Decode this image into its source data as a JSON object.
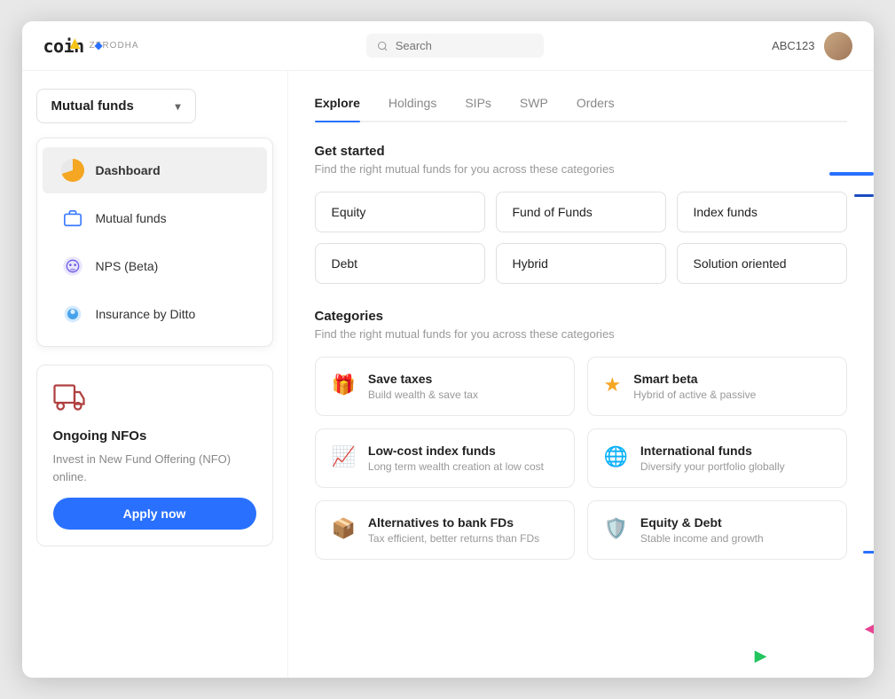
{
  "app": {
    "logo": "coin",
    "logo_sub": "ZERODHA",
    "search_placeholder": "Search"
  },
  "user": {
    "id": "ABC123"
  },
  "sidebar": {
    "dropdown_label": "Mutual funds",
    "nav_items": [
      {
        "id": "dashboard",
        "label": "Dashboard",
        "icon": "pie-chart",
        "active": true
      },
      {
        "id": "mutual-funds",
        "label": "Mutual funds",
        "icon": "briefcase",
        "active": false
      },
      {
        "id": "nps",
        "label": "NPS (Beta)",
        "icon": "nps",
        "active": false
      },
      {
        "id": "insurance",
        "label": "Insurance by Ditto",
        "icon": "droplet",
        "active": false
      }
    ],
    "nfo": {
      "title": "Ongoing NFOs",
      "description": "Invest in New Fund Offering (NFO) online.",
      "apply_label": "Apply now"
    }
  },
  "tabs": [
    {
      "id": "explore",
      "label": "Explore",
      "active": true
    },
    {
      "id": "holdings",
      "label": "Holdings",
      "active": false
    },
    {
      "id": "sips",
      "label": "SIPs",
      "active": false
    },
    {
      "id": "swp",
      "label": "SWP",
      "active": false
    },
    {
      "id": "orders",
      "label": "Orders",
      "active": false
    }
  ],
  "get_started": {
    "title": "Get started",
    "description": "Find the right mutual funds for you across these categories",
    "fund_types": [
      {
        "id": "equity",
        "label": "Equity"
      },
      {
        "id": "fund-of-funds",
        "label": "Fund of Funds"
      },
      {
        "id": "index-funds",
        "label": "Index funds"
      },
      {
        "id": "debt",
        "label": "Debt"
      },
      {
        "id": "hybrid",
        "label": "Hybrid"
      },
      {
        "id": "solution-oriented",
        "label": "Solution oriented"
      }
    ]
  },
  "categories": {
    "title": "Categories",
    "description": "Find the right mutual funds for you across these categories",
    "items": [
      {
        "id": "save-taxes",
        "icon": "🎁",
        "title": "Save taxes",
        "description": "Build wealth & save tax"
      },
      {
        "id": "smart-beta",
        "icon": "⭐",
        "title": "Smart beta",
        "description": "Hybrid of active & passive"
      },
      {
        "id": "low-cost-index",
        "icon": "📈",
        "title": "Low-cost index funds",
        "description": "Long term wealth creation at low cost"
      },
      {
        "id": "international",
        "icon": "🌐",
        "title": "International funds",
        "description": "Diversify your portfolio globally"
      },
      {
        "id": "alternatives-fd",
        "icon": "📦",
        "title": "Alternatives to bank FDs",
        "description": "Tax efficient, better returns than FDs"
      },
      {
        "id": "equity-debt",
        "icon": "🛡️",
        "title": "Equity & Debt",
        "description": "Stable income and growth"
      }
    ]
  }
}
